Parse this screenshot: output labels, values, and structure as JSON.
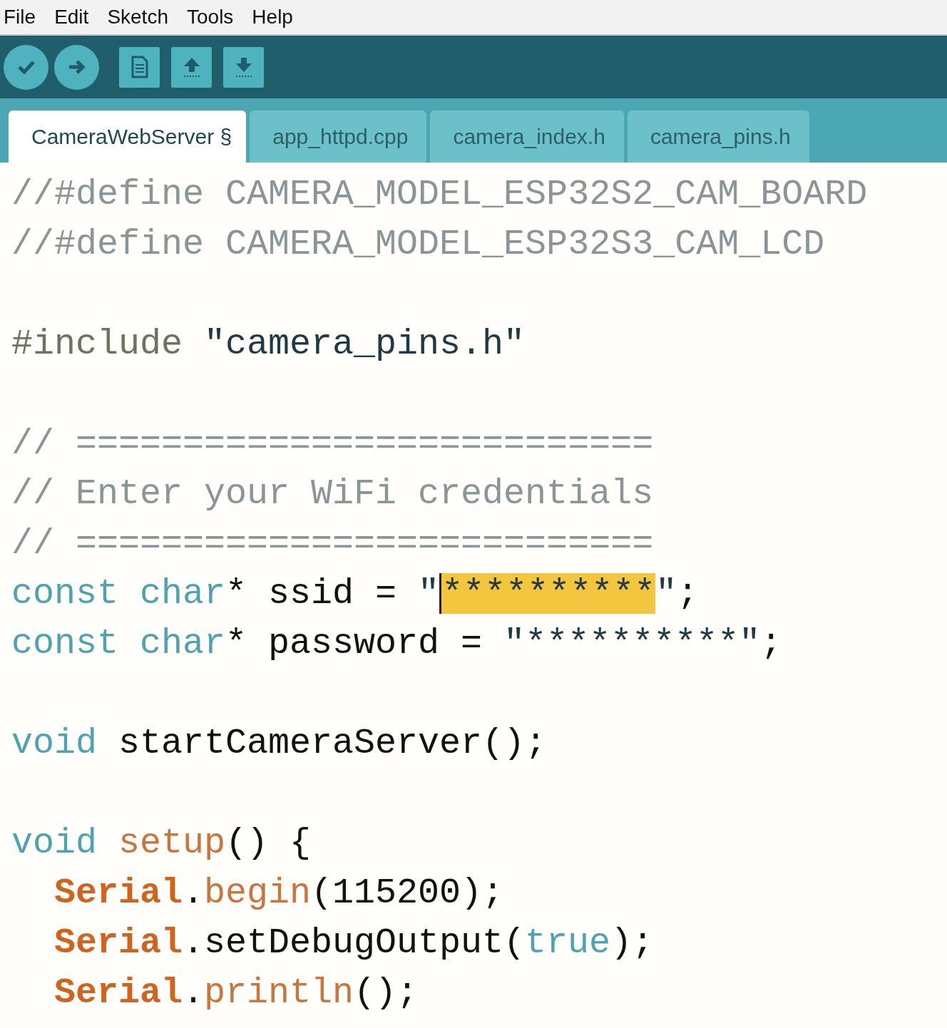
{
  "menu": [
    "File",
    "Edit",
    "Sketch",
    "Tools",
    "Help"
  ],
  "toolbar": [
    {
      "kind": "verify"
    },
    {
      "kind": "upload"
    },
    {
      "kind": "new"
    },
    {
      "kind": "open"
    },
    {
      "kind": "save"
    }
  ],
  "tabs": [
    {
      "label": "CameraWebServer §",
      "selected": true
    },
    {
      "label": "app_httpd.cpp",
      "selected": false
    },
    {
      "label": "camera_index.h",
      "selected": false
    },
    {
      "label": "camera_pins.h",
      "selected": false
    }
  ],
  "code": [
    {
      "tokens": [
        {
          "text": "//#define CAMERA_MODEL_ESP32S2_CAM_BOARD",
          "kind": "comment"
        }
      ]
    },
    {
      "tokens": [
        {
          "text": "//#define CAMERA_MODEL_ESP32S3_CAM_LCD",
          "kind": "comment"
        }
      ]
    },
    {
      "blank": true
    },
    {
      "tokens": [
        {
          "text": "#include ",
          "kind": "preprocessor"
        },
        {
          "text": "\"camera_pins.h\"",
          "kind": "string"
        }
      ]
    },
    {
      "blank": true
    },
    {
      "tokens": [
        {
          "text": "// ===========================",
          "kind": "comment"
        }
      ]
    },
    {
      "tokens": [
        {
          "text": "// Enter your WiFi credentials",
          "kind": "comment"
        }
      ]
    },
    {
      "tokens": [
        {
          "text": "// ===========================",
          "kind": "comment"
        }
      ]
    },
    {
      "tokens": [
        {
          "text": "const char",
          "kind": "keyword"
        },
        {
          "text": "* ssid = ",
          "kind": "plain"
        },
        {
          "text": "\"",
          "kind": "string"
        },
        {
          "text": "**********",
          "kind": "selection"
        },
        {
          "text": "\"",
          "kind": "string"
        },
        {
          "text": ";",
          "kind": "plain"
        }
      ]
    },
    {
      "tokens": [
        {
          "text": "const char",
          "kind": "keyword"
        },
        {
          "text": "* password = ",
          "kind": "plain"
        },
        {
          "text": "\"**********\"",
          "kind": "string"
        },
        {
          "text": ";",
          "kind": "plain"
        }
      ]
    },
    {
      "blank": true
    },
    {
      "tokens": [
        {
          "text": "void",
          "kind": "keyword"
        },
        {
          "text": " startCameraServer();",
          "kind": "plain"
        }
      ]
    },
    {
      "blank": true
    },
    {
      "tokens": [
        {
          "text": "void ",
          "kind": "keyword"
        },
        {
          "text": "setup",
          "kind": "function"
        },
        {
          "text": "() {",
          "kind": "plain"
        }
      ]
    },
    {
      "indented": true,
      "tokens": [
        {
          "text": "Serial",
          "kind": "class"
        },
        {
          "text": ".",
          "kind": "plain"
        },
        {
          "text": "begin",
          "kind": "function"
        },
        {
          "text": "(115200);",
          "kind": "plain"
        }
      ]
    },
    {
      "indented": true,
      "tokens": [
        {
          "text": "Serial",
          "kind": "class"
        },
        {
          "text": ".setDebugOutput(",
          "kind": "plain"
        },
        {
          "text": "true",
          "kind": "keyword"
        },
        {
          "text": ");",
          "kind": "plain"
        }
      ]
    },
    {
      "indented": true,
      "tokens": [
        {
          "text": "Serial",
          "kind": "class"
        },
        {
          "text": ".",
          "kind": "plain"
        },
        {
          "text": "println",
          "kind": "function"
        },
        {
          "text": "();",
          "kind": "plain"
        }
      ]
    }
  ]
}
